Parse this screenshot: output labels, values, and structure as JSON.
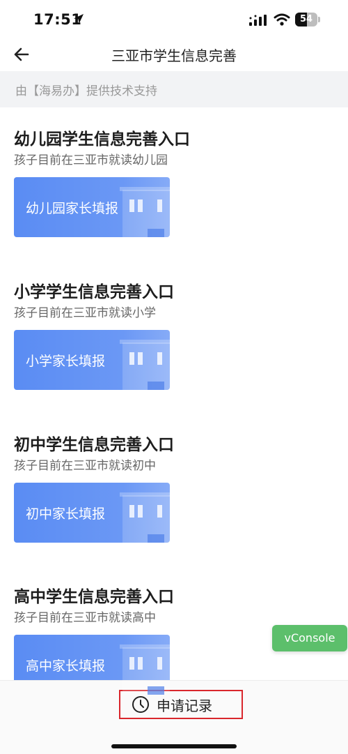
{
  "status_bar": {
    "time": "17:51",
    "battery_level": "54"
  },
  "nav": {
    "title": "三亚市学生信息完善"
  },
  "support_text": "由【海易办】提供技术支持",
  "sections": [
    {
      "title": "幼儿园学生信息完善入口",
      "subtitle": "孩子目前在三亚市就读幼儿园",
      "button_label": "幼儿园家长填报"
    },
    {
      "title": "小学学生信息完善入口",
      "subtitle": "孩子目前在三亚市就读小学",
      "button_label": "小学家长填报"
    },
    {
      "title": "初中学生信息完善入口",
      "subtitle": "孩子目前在三亚市就读初中",
      "button_label": "初中家长填报"
    },
    {
      "title": "高中学生信息完善入口",
      "subtitle": "孩子目前在三亚市就读高中",
      "button_label": "高中家长填报"
    }
  ],
  "vconsole_label": "vConsole",
  "bottom": {
    "records_label": "申请记录"
  },
  "colors": {
    "card_blue": "#5a8cf3",
    "vconsole_green": "#5cbf6b",
    "highlight_red": "#d9262c"
  }
}
